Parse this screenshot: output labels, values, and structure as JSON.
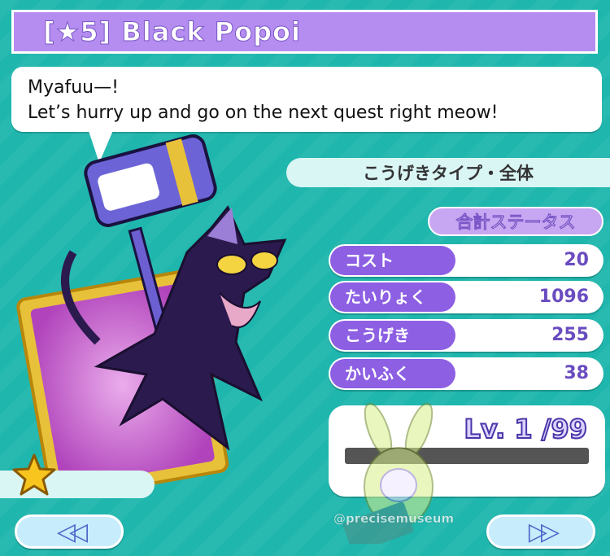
{
  "title": "[★5]  Black Popoi",
  "speech": {
    "line1": "Myafuu—!",
    "line2": "Let’s hurry up and go on the next quest right meow!"
  },
  "type_label": "こうげきタイプ・全体",
  "total_status_label": "合計ステータス",
  "stats": [
    {
      "label": "コスト",
      "value": "20"
    },
    {
      "label": "たいりょく",
      "value": "1096"
    },
    {
      "label": "こうげき",
      "value": "255"
    },
    {
      "label": "かいふく",
      "value": "38"
    }
  ],
  "level": {
    "text": "Lv. 1 /99",
    "current": 1,
    "max": 99,
    "exp_fraction": 0
  },
  "watermark": "@precisemuseum",
  "icons": {
    "rarity": "star-icon",
    "prev": "double-left-arrow-icon",
    "next": "double-right-arrow-icon"
  },
  "colors": {
    "background": "#1fb6ad",
    "title_bar": "#b58df0",
    "stat_label": "#8d5fe3"
  }
}
